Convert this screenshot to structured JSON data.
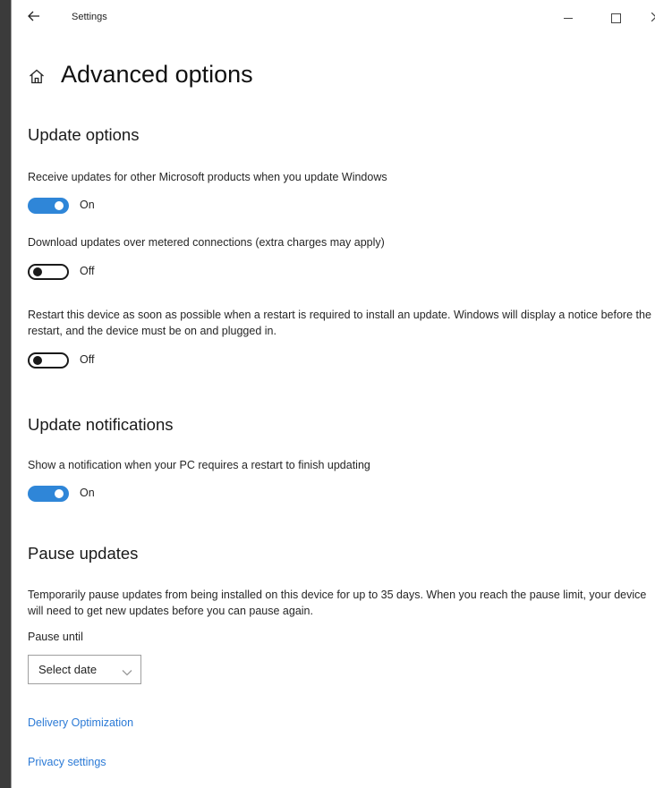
{
  "window": {
    "title": "Settings",
    "icons": {
      "back": "back-arrow-icon",
      "minimize": "minimize-icon",
      "maximize": "maximize-icon",
      "close": "close-icon"
    }
  },
  "header": {
    "title": "Advanced options",
    "icon": "home-icon"
  },
  "sections": {
    "update_options": {
      "heading": "Update options",
      "settings": [
        {
          "description": "Receive updates for other Microsoft products when you update Windows",
          "state": "On",
          "enabled": true
        },
        {
          "description": "Download updates over metered connections (extra charges may apply)",
          "state": "Off",
          "enabled": false
        },
        {
          "description": "Restart this device as soon as possible when a restart is required to install an update. Windows will display a notice before the restart, and the device must be on and plugged in.",
          "state": "Off",
          "enabled": false
        }
      ]
    },
    "update_notifications": {
      "heading": "Update notifications",
      "settings": [
        {
          "description": "Show a notification when your PC requires a restart to finish updating",
          "state": "On",
          "enabled": true
        }
      ]
    },
    "pause_updates": {
      "heading": "Pause updates",
      "description": "Temporarily pause updates from being installed on this device for up to 35 days. When you reach the pause limit, your device will need to get new updates before you can pause again.",
      "pause_until_label": "Pause until",
      "select_value": "Select date"
    }
  },
  "links": {
    "delivery_optimization": "Delivery Optimization",
    "privacy_settings": "Privacy settings"
  },
  "colors": {
    "accent": "#2f86d8",
    "link": "#2b7ad6"
  }
}
